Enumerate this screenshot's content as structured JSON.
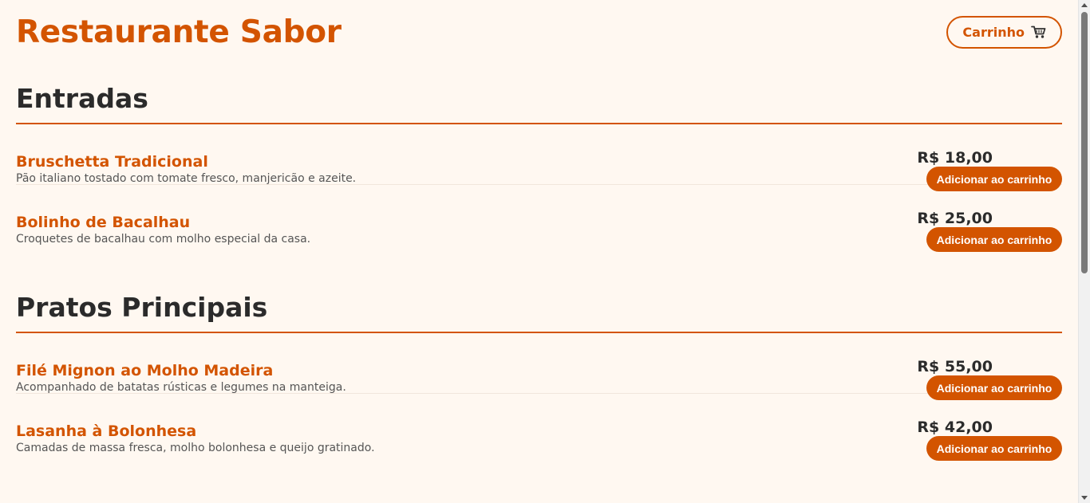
{
  "header": {
    "title": "Restaurante Sabor",
    "cart_label": "Carrinho",
    "cart_icon": "shopping-cart-icon"
  },
  "sections": [
    {
      "title": "Entradas",
      "items": [
        {
          "name": "Bruschetta Tradicional",
          "description": "Pão italiano tostado com tomate fresco, manjericão e azeite.",
          "price": "R$ 18,00",
          "button_label": "Adicionar ao carrinho"
        },
        {
          "name": "Bolinho de Bacalhau",
          "description": "Croquetes de bacalhau com molho especial da casa.",
          "price": "R$ 25,00",
          "button_label": "Adicionar ao carrinho"
        }
      ]
    },
    {
      "title": "Pratos Principais",
      "items": [
        {
          "name": "Filé Mignon ao Molho Madeira",
          "description": "Acompanhado de batatas rústicas e legumes na manteiga.",
          "price": "R$ 55,00",
          "button_label": "Adicionar ao carrinho"
        },
        {
          "name": "Lasanha à Bolonhesa",
          "description": "Camadas de massa fresca, molho bolonhesa e queijo gratinado.",
          "price": "R$ 42,00",
          "button_label": "Adicionar ao carrinho"
        }
      ]
    }
  ],
  "colors": {
    "accent": "#d35400",
    "background": "#fff8f1",
    "text": "#2b2b2b"
  }
}
